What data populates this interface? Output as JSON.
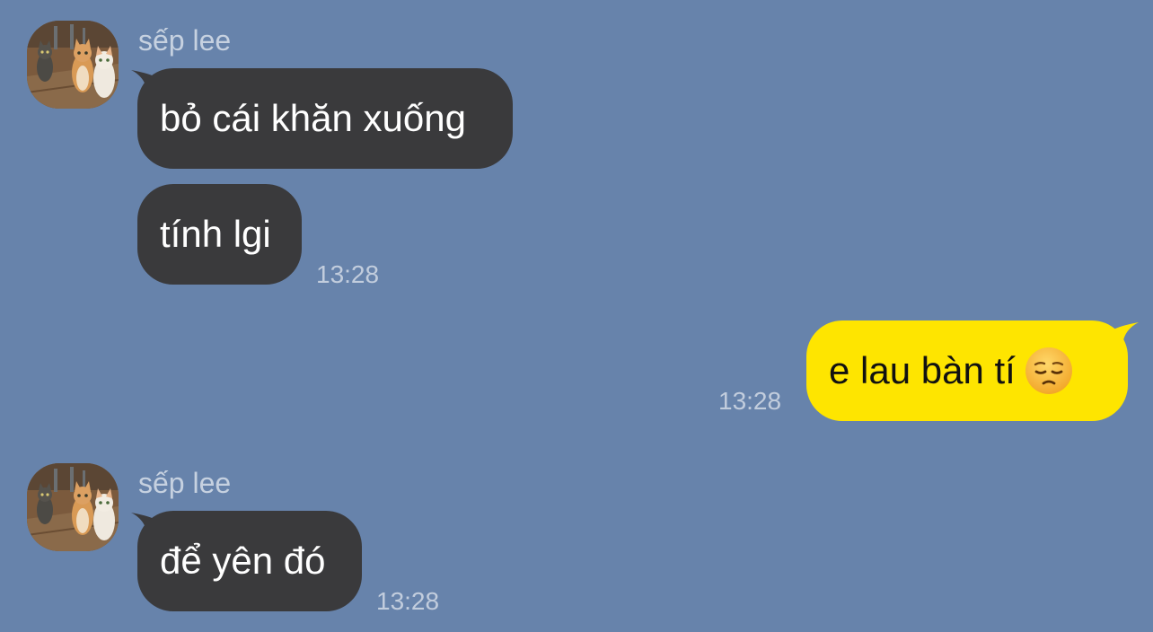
{
  "messages": [
    {
      "sender": "sếp lee",
      "bubbles": [
        "bỏ cái khăn xuống",
        "tính lgi"
      ],
      "time": "13:28"
    },
    {
      "bubbles": [
        "e lau bàn tí"
      ],
      "emoji": "pensive-face-icon",
      "time": "13:28"
    },
    {
      "sender": "sếp lee",
      "bubbles": [
        "để yên đó"
      ],
      "time": "13:28"
    }
  ],
  "colors": {
    "background": "#6783ab",
    "incoming_bubble": "#3a3a3c",
    "outgoing_bubble": "#fee500"
  }
}
